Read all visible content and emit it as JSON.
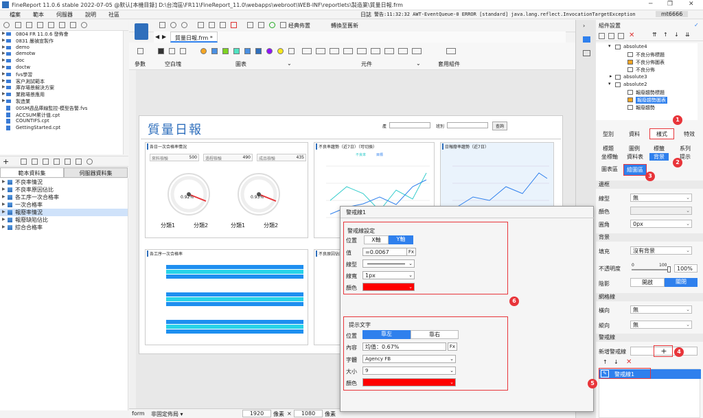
{
  "app": {
    "title": "FineReport 11.0.6 stable 2022-07-05 @默认[本機目錄]    D:\\台湾區\\FR11\\FineReport_11.0\\webapps\\webroot\\WEB-INF\\reportlets\\製造業\\質量日報.frm"
  },
  "menu": [
    "檔案",
    "範本",
    "伺服器",
    "說明",
    "社區"
  ],
  "log": {
    "label": "日誌",
    "text": "警告:11:32:32 AWT-EventQueue-0 ERROR [standard] java.lang.reflect.InvocationTargetException",
    "user": "mt6666"
  },
  "filetree": [
    {
      "label": "0804 FR 11.0.6 發佈會",
      "type": "folder"
    },
    {
      "label": "0831 嚴禎宣製作",
      "type": "folder"
    },
    {
      "label": "demo",
      "type": "folder"
    },
    {
      "label": "demotw",
      "type": "folder"
    },
    {
      "label": "doc",
      "type": "folder"
    },
    {
      "label": "doctw",
      "type": "folder"
    },
    {
      "label": "fvs學習",
      "type": "folder"
    },
    {
      "label": "客户測試範本",
      "type": "folder"
    },
    {
      "label": "庫存場景解決方案",
      "type": "folder"
    },
    {
      "label": "業務場景應用",
      "type": "folder"
    },
    {
      "label": "製造業",
      "type": "folder"
    },
    {
      "label": "00SM週品庫線監控-模型告警.fvs",
      "type": "file"
    },
    {
      "label": "ACCSUM累计值.cpt",
      "type": "file"
    },
    {
      "label": "COUNTIFS.cpt",
      "type": "file"
    },
    {
      "label": "GettingStarted.cpt",
      "type": "file"
    }
  ],
  "dstabs": {
    "left": "範本資料集",
    "right": "伺服器資料集"
  },
  "datasets": [
    "不良率情況",
    "不良率原因佔比",
    "各工序一次合格率",
    "一次合格率",
    "報廢率情況",
    "報廢缺陷佔比",
    "綜合合格率"
  ],
  "doctab": {
    "label": "質量日報.frm *"
  },
  "toolbar": {
    "classic": "经典佈置",
    "switch": "轉換至舊新"
  },
  "ribbon": {
    "param": "參數",
    "blank": "空白塊",
    "chart": "圖表",
    "widget": "元件",
    "apply": "套用組件"
  },
  "canvas": {
    "title": "質量日報",
    "filter_label": "產",
    "shift_label": "班別",
    "query_btn": "查詢",
    "card1": {
      "title": "各日一次合格率情況",
      "kpis": [
        {
          "label": "來料檢驗",
          "value": "500"
        },
        {
          "label": "過程檢驗",
          "value": "490"
        },
        {
          "label": "成品檢驗",
          "value": "435"
        }
      ],
      "gauges": [
        {
          "pct": "0.92%",
          "labels": [
            "分類1",
            "分類2"
          ]
        },
        {
          "pct": "0.93%",
          "labels": [
            "分類1",
            "分類2"
          ]
        }
      ]
    },
    "card2": {
      "title": "不良率趨勢（近7日）（可切換）",
      "legend": [
        "不良率",
        "目標"
      ]
    },
    "card3": {
      "title": "日報廢率趨勢（近7日）"
    },
    "card4": {
      "title": "各工序一次合格率"
    },
    "card5": {
      "title": "不良原因佔比"
    }
  },
  "status": {
    "mode": "form",
    "layout": "非固定佈局",
    "width": "1920",
    "unit": "像素",
    "x": "×",
    "height": "1080",
    "unit2": "像素"
  },
  "rightpanel": {
    "header": "組件設置",
    "tree": [
      {
        "label": "absolute4",
        "level": 0,
        "open": true
      },
      {
        "label": "不良分佈標題",
        "level": 1
      },
      {
        "label": "不良分佈圖表",
        "level": 1
      },
      {
        "label": "不良分佈",
        "level": 1
      },
      {
        "label": "absolute3",
        "level": 0,
        "open": false
      },
      {
        "label": "absolute2",
        "level": 0,
        "open": true
      },
      {
        "label": "報廢趨勢標題",
        "level": 1
      },
      {
        "label": "報廢趨勢圖表",
        "level": 1,
        "selected": true
      },
      {
        "label": "報廢趨勢",
        "level": 1
      }
    ],
    "maintabs": [
      "型別",
      "資料",
      "樣式",
      "特效"
    ],
    "subtabs1": [
      "標題",
      "圖例",
      "標籤",
      "系列"
    ],
    "subtabs2": [
      "坐標軸",
      "資料表",
      "背景",
      "提示"
    ],
    "subtabs3": [
      "圖表區",
      "繪圖區"
    ],
    "sections": {
      "border": "邊框",
      "background": "背景",
      "gridline": "網格線",
      "alertline": "警戒線"
    },
    "rows": {
      "linetype": "線型",
      "linetype_val": "無",
      "color": "顏色",
      "radius": "圓角",
      "radius_val": "0px",
      "fill": "填充",
      "fill_val": "沒有背景",
      "opacity": "不透明度",
      "opacity_min": "0",
      "opacity_max": "100",
      "opacity_val": "100%",
      "shadow": "陰影",
      "shadow_on": "開啟",
      "shadow_off": "關閉",
      "horizontal": "橫向",
      "horizontal_val": "無",
      "vertical": "縱向",
      "vertical_val": "無",
      "add_alert": "新增警戒線",
      "alert_item": "警戒線1"
    }
  },
  "dialog": {
    "title": "警戒線1",
    "section1": "警戒線設定",
    "position": "位置",
    "axis_x": "X軸",
    "axis_y": "Y軸",
    "value_label": "值",
    "value": "=0.0067",
    "linetype": "線型",
    "linewidth": "線寬",
    "linewidth_val": "1px",
    "color": "顏色",
    "section2": "提示文字",
    "pos_left": "靠左",
    "pos_right": "靠右",
    "content": "內容",
    "content_val": "均值：0.67%",
    "font": "字體",
    "font_val": "Agency FB",
    "size": "大小",
    "size_val": "9",
    "color2": "顏色",
    "alert_color": "#ff0000"
  },
  "badges": [
    "1",
    "2",
    "3",
    "4",
    "5",
    "6"
  ],
  "accent": "#2f80ed",
  "highlight": "#e8353a"
}
